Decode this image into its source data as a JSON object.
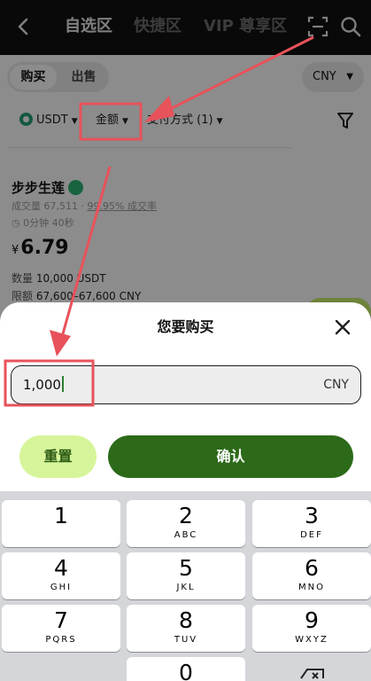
{
  "top_nav": {
    "tabs": [
      {
        "label": "自选区",
        "active": true
      },
      {
        "label": "快捷区",
        "active": false
      },
      {
        "label": "VIP 尊享区",
        "active": false
      }
    ]
  },
  "trade": {
    "segment": {
      "buy": "购买",
      "sell": "出售"
    },
    "currency": "CNY",
    "filters": {
      "asset": "USDT",
      "amount": "金额",
      "payment": "支付方式 (1)"
    }
  },
  "listing": {
    "merchant": "步步生莲",
    "volume_text": "成交量 67,511",
    "rate_text": "99.95% 成交率",
    "time_text": "0分钟 40秒",
    "price_symbol": "¥",
    "price": "6.79",
    "quantity_label": "数量",
    "quantity_value": "10,000 USDT",
    "limit_label": "限额",
    "limit_value": "67,600–67,600 CNY"
  },
  "sheet": {
    "title": "您要购买",
    "amount_value": "1,000",
    "amount_currency": "CNY",
    "reset_label": "重置",
    "confirm_label": "确认"
  },
  "keypad": {
    "keys": [
      {
        "digit": "1",
        "letters": ""
      },
      {
        "digit": "2",
        "letters": "ABC"
      },
      {
        "digit": "3",
        "letters": "DEF"
      },
      {
        "digit": "4",
        "letters": "GHI"
      },
      {
        "digit": "5",
        "letters": "JKL"
      },
      {
        "digit": "6",
        "letters": "MNO"
      },
      {
        "digit": "7",
        "letters": "PQRS"
      },
      {
        "digit": "8",
        "letters": "TUV"
      },
      {
        "digit": "9",
        "letters": "WXYZ"
      },
      {
        "digit": "0",
        "letters": ""
      }
    ]
  },
  "annotation_color": "#e8525a",
  "colors": {
    "accent_green": "#2c6a1a",
    "light_green": "#d6f59a"
  }
}
